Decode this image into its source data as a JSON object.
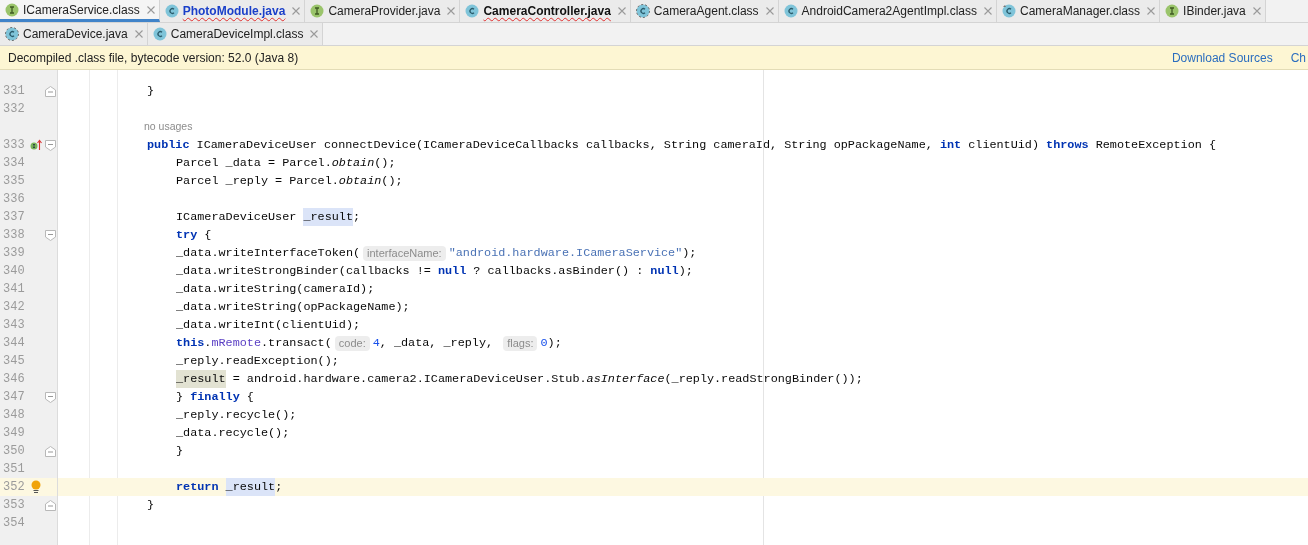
{
  "tab_rows": [
    [
      {
        "label": "ICameraService.class",
        "kind": "interface",
        "selected": true,
        "bold": false,
        "color": "#222222",
        "errors": false
      },
      {
        "label": "PhotoModule.java",
        "kind": "class",
        "selected": false,
        "bold": true,
        "color": "#1a3fc9",
        "errors": true
      },
      {
        "label": "CameraProvider.java",
        "kind": "interface",
        "selected": false,
        "bold": false,
        "color": "#222222",
        "errors": false
      },
      {
        "label": "CameraController.java",
        "kind": "class",
        "selected": false,
        "bold": true,
        "color": "#111111",
        "errors": true
      },
      {
        "label": "CameraAgent.class",
        "kind": "abstract",
        "selected": false,
        "bold": false,
        "color": "#222222",
        "errors": false
      },
      {
        "label": "AndroidCamera2AgentImpl.class",
        "kind": "class",
        "selected": false,
        "bold": false,
        "color": "#222222",
        "errors": false
      },
      {
        "label": "CameraManager.class",
        "kind": "final",
        "selected": false,
        "bold": false,
        "color": "#222222",
        "errors": false
      },
      {
        "label": "IBinder.java",
        "kind": "interface",
        "selected": false,
        "bold": false,
        "color": "#222222",
        "errors": false
      }
    ],
    [
      {
        "label": "CameraDevice.java",
        "kind": "abstract",
        "selected": false,
        "bold": false,
        "color": "#222222",
        "errors": false
      },
      {
        "label": "CameraDeviceImpl.class",
        "kind": "class",
        "selected": false,
        "bold": false,
        "color": "#222222",
        "errors": false
      }
    ]
  ],
  "banner": {
    "message": "Decompiled .class file, bytecode version: 52.0 (Java 8)",
    "links": [
      "Download Sources",
      "Ch"
    ]
  },
  "lines": [
    {
      "kind": "code",
      "number": "331",
      "fold": {
        "kind": "end"
      },
      "tokens": [
        {
          "kind": "plain",
          "text": "}"
        }
      ]
    },
    {
      "kind": "code",
      "number": "332"
    },
    {
      "kind": "usage",
      "text": "no usages"
    },
    {
      "kind": "code",
      "number": "333",
      "marker": {
        "kind": "implements"
      },
      "fold": {
        "kind": "start"
      },
      "tokens": [
        {
          "kind": "keyword",
          "text": "public"
        },
        {
          "kind": "plain",
          "text": " ICameraDeviceUser connectDevice(ICameraDeviceCallbacks callbacks, String cameraId, String opPackageName, "
        },
        {
          "kind": "keyword",
          "text": "int"
        },
        {
          "kind": "plain",
          "text": " clientUid) "
        },
        {
          "kind": "keyword",
          "text": "throws"
        },
        {
          "kind": "plain",
          "text": " RemoteException {"
        }
      ],
      "children": [
        {
          "kind": "code",
          "number": "334",
          "tokens": [
            {
              "kind": "plain",
              "text": "Parcel _data = Parcel."
            },
            {
              "kind": "call",
              "text": "obtain"
            },
            {
              "kind": "plain",
              "text": "();"
            }
          ]
        },
        {
          "kind": "code",
          "number": "335",
          "tokens": [
            {
              "kind": "plain",
              "text": "Parcel _reply = Parcel."
            },
            {
              "kind": "call",
              "text": "obtain"
            },
            {
              "kind": "plain",
              "text": "();"
            }
          ]
        },
        {
          "kind": "code",
          "number": "336"
        },
        {
          "kind": "code",
          "number": "337",
          "tokens": [
            {
              "kind": "plain",
              "text": "ICameraDeviceUser"
            },
            {
              "kind": "ref",
              "text": "_result",
              "spaced": true
            },
            {
              "kind": "plain",
              "text": ";"
            }
          ]
        },
        {
          "kind": "code",
          "number": "338",
          "fold": {
            "kind": "start"
          },
          "tokens": [
            {
              "kind": "keyword",
              "text": "try"
            },
            {
              "kind": "plain",
              "text": " {"
            }
          ],
          "children": [
            {
              "kind": "code",
              "number": "339",
              "tokens": [
                {
                  "kind": "plain",
                  "text": "_data.writeInterfaceToken("
                },
                {
                  "kind": "hint",
                  "text": "interfaceName:"
                },
                {
                  "kind": "string",
                  "text": "\"android.hardware.ICameraService\""
                },
                {
                  "kind": "plain",
                  "text": ");"
                }
              ]
            },
            {
              "kind": "code",
              "number": "340",
              "tokens": [
                {
                  "kind": "plain",
                  "text": "_data.writeStrongBinder(callbacks != "
                },
                {
                  "kind": "keyword",
                  "text": "null"
                },
                {
                  "kind": "plain",
                  "text": " ? callbacks.asBinder() : "
                },
                {
                  "kind": "keyword",
                  "text": "null"
                },
                {
                  "kind": "plain",
                  "text": ");"
                }
              ]
            },
            {
              "kind": "code",
              "number": "341",
              "tokens": [
                {
                  "kind": "plain",
                  "text": "_data.writeString(cameraId);"
                }
              ]
            },
            {
              "kind": "code",
              "number": "342",
              "tokens": [
                {
                  "kind": "plain",
                  "text": "_data.writeString(opPackageName);"
                }
              ]
            },
            {
              "kind": "code",
              "number": "343",
              "tokens": [
                {
                  "kind": "plain",
                  "text": "_data.writeInt(clientUid);"
                }
              ]
            },
            {
              "kind": "code",
              "number": "344",
              "tokens": [
                {
                  "kind": "keyword",
                  "text": "this"
                },
                {
                  "kind": "plain",
                  "text": "."
                },
                {
                  "kind": "field",
                  "text": "mRemote"
                },
                {
                  "kind": "plain",
                  "text": ".transact("
                },
                {
                  "kind": "hint",
                  "text": "code:"
                },
                {
                  "kind": "number",
                  "text": "4"
                },
                {
                  "kind": "plain",
                  "text": ", _data, _reply, "
                },
                {
                  "kind": "hint",
                  "text": "flags:"
                },
                {
                  "kind": "number",
                  "text": "0"
                },
                {
                  "kind": "plain",
                  "text": ");"
                }
              ]
            },
            {
              "kind": "code",
              "number": "345",
              "tokens": [
                {
                  "kind": "plain",
                  "text": "_reply.readException();"
                }
              ]
            },
            {
              "kind": "code",
              "number": "346",
              "tokens": [
                {
                  "kind": "write",
                  "text": "_result"
                },
                {
                  "kind": "plain",
                  "text": " = android.hardware.camera2.ICameraDeviceUser.Stub."
                },
                {
                  "kind": "call",
                  "text": "asInterface"
                },
                {
                  "kind": "plain",
                  "text": "(_reply.readStrongBinder());"
                }
              ]
            }
          ]
        },
        {
          "kind": "code",
          "number": "347",
          "fold": {
            "kind": "start"
          },
          "tokens": [
            {
              "kind": "plain",
              "text": "} "
            },
            {
              "kind": "keyword",
              "text": "finally"
            },
            {
              "kind": "plain",
              "text": " {"
            }
          ],
          "children": [
            {
              "kind": "code",
              "number": "348",
              "tokens": [
                {
                  "kind": "plain",
                  "text": "_reply.recycle();"
                }
              ]
            },
            {
              "kind": "code",
              "number": "349",
              "tokens": [
                {
                  "kind": "plain",
                  "text": "_data.recycle();"
                }
              ]
            }
          ]
        },
        {
          "kind": "code",
          "number": "350",
          "fold": {
            "kind": "end"
          },
          "tokens": [
            {
              "kind": "plain",
              "text": "}"
            }
          ]
        },
        {
          "kind": "code",
          "number": "351"
        },
        {
          "kind": "code",
          "number": "352",
          "marker": {
            "kind": "bulb"
          },
          "current": true,
          "tokens": [
            {
              "kind": "keyword",
              "text": "return"
            },
            {
              "kind": "ref",
              "text": "_result",
              "spaced": true
            },
            {
              "kind": "plain",
              "text": ";"
            }
          ]
        }
      ]
    },
    {
      "kind": "code",
      "number": "353",
      "fold": {
        "kind": "end"
      },
      "tokens": [
        {
          "kind": "plain",
          "text": "}"
        }
      ]
    },
    {
      "kind": "code",
      "number": "354"
    }
  ]
}
